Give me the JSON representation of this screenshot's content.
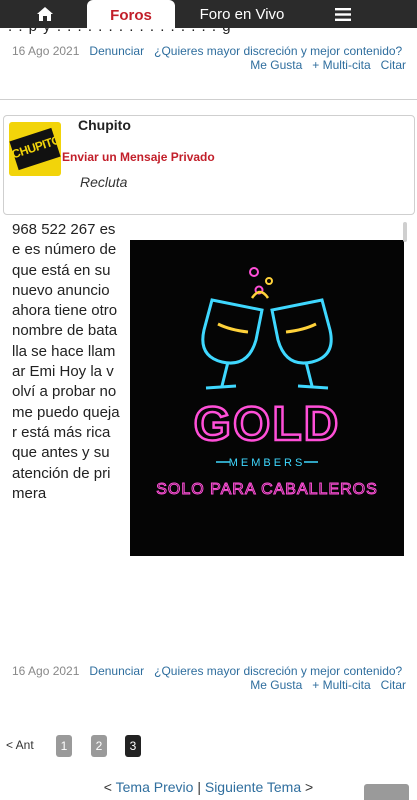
{
  "nav": {
    "home_icon": "home-icon",
    "tab_foros": "Foros",
    "tab_vivo": "Foro en Vivo",
    "menu_icon": "hamburger-menu-icon",
    "colors": {
      "bar": "#2b2b2b",
      "active_text": "#c21f2a"
    }
  },
  "previous_post": {
    "date": "16 Ago 2021",
    "report_label": "Denunciar",
    "discretion_link": "¿Quieres mayor discreción y mejor contenido?",
    "actions": [
      "Me Gusta",
      "+ Multi-cita",
      "Citar"
    ]
  },
  "post": {
    "author": {
      "username": "Chupito",
      "avatar_text": "CHUPITO",
      "private_message_label": "Enviar un Mensaje Privado",
      "rank": "Recluta"
    },
    "image": {
      "brand": "GOLD",
      "sub": "MEMBERS",
      "tagline": "SOLO PARA CABALLEROS"
    },
    "body_text": "968 522 267 ese es número de que está en su nuevo anuncio ahora tiene otro nombre de batalla se hace llamar Emi Hoy la volví a probar no me puedo quejar está más rica que antes y su atención de primera",
    "date": "16 Ago 2021",
    "report_label": "Denunciar",
    "discretion_link": "¿Quieres mayor discreción y mejor contenido?",
    "actions": [
      "Me Gusta",
      "+ Multi-cita",
      "Citar"
    ]
  },
  "pagination": {
    "prev_label": "< Ant",
    "pages": [
      "1",
      "2",
      "3"
    ],
    "current_page": "3"
  },
  "thread_nav": {
    "prev_label": "Tema Previo",
    "next_label": "Siguiente Tema",
    "open": "<",
    "separator": "|",
    "close": ">"
  }
}
